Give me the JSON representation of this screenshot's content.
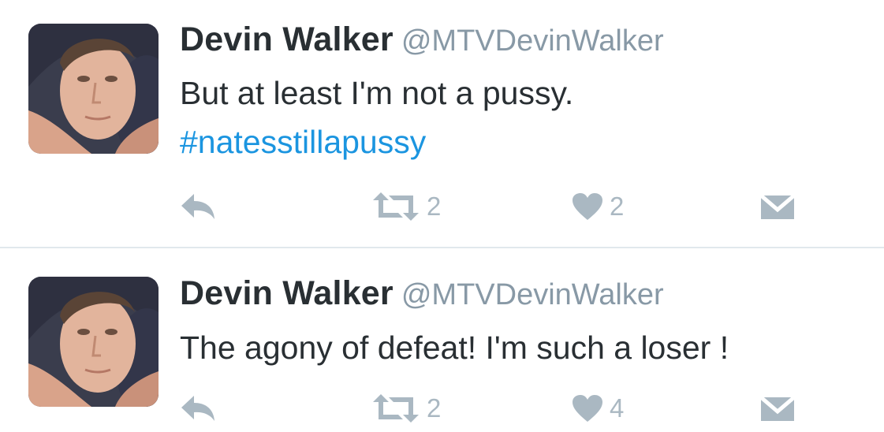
{
  "tweets": [
    {
      "author_name": "Devin Walker",
      "author_handle": "@MTVDevinWalker",
      "text": "But at least I'm not a pussy.",
      "hashtag": "#natesstillapussy",
      "retweet_count": "2",
      "like_count": "2"
    },
    {
      "author_name": "Devin Walker",
      "author_handle": "@MTVDevinWalker",
      "text": "The agony of defeat! I'm such a loser !",
      "hashtag": "",
      "retweet_count": "2",
      "like_count": "4"
    }
  ],
  "icons": {
    "reply": "reply-icon",
    "retweet": "retweet-icon",
    "like": "heart-icon",
    "direct_message": "envelope-icon"
  },
  "colors": {
    "text": "#292f33",
    "handle": "#8899a6",
    "hashtag": "#1b95e0",
    "action_icon": "#aab8c2",
    "divider": "#e1e8ed"
  }
}
